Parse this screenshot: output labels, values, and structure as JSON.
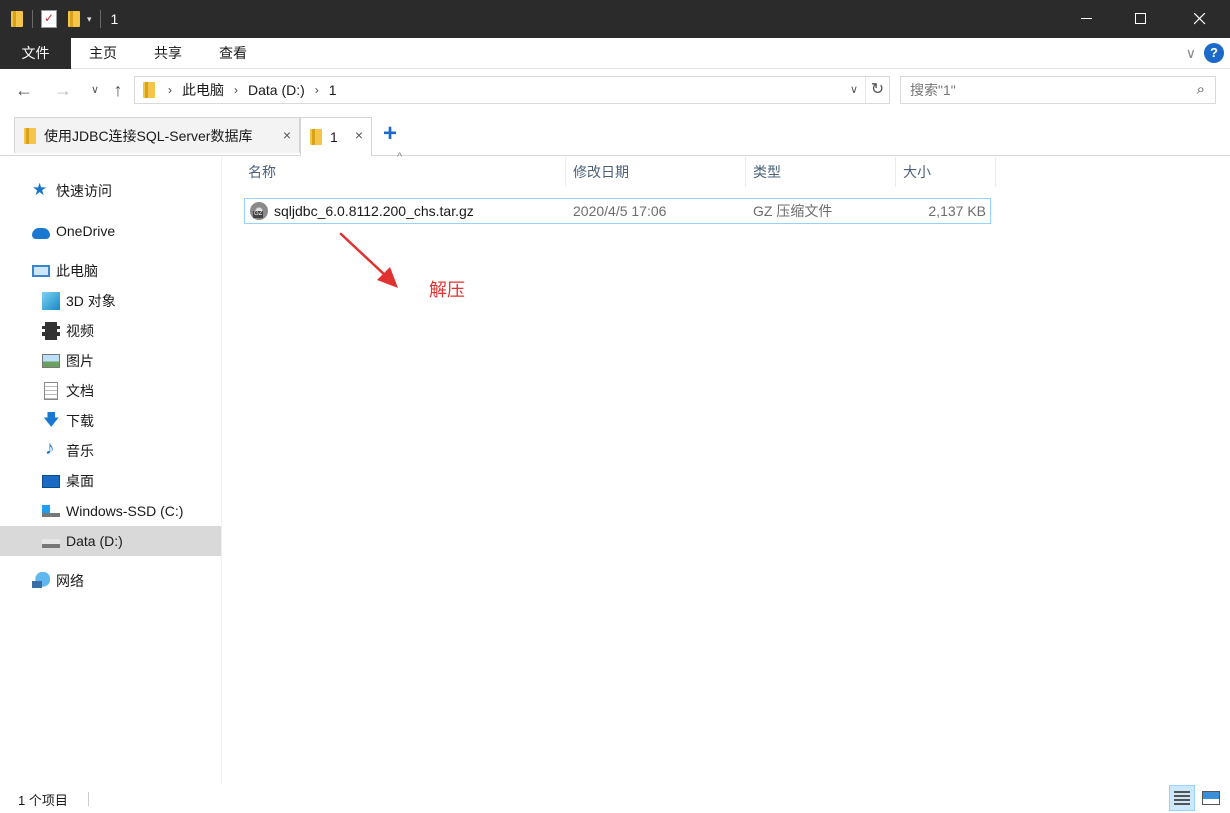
{
  "window": {
    "title": "1"
  },
  "ribbon": {
    "tabs": [
      "文件",
      "主页",
      "共享",
      "查看"
    ]
  },
  "address": {
    "crumbs": [
      "此电脑",
      "Data (D:)",
      "1"
    ]
  },
  "search": {
    "placeholder": "搜索\"1\""
  },
  "tabs": [
    {
      "label": "使用JDBC连接SQL-Server数据库"
    },
    {
      "label": "1"
    }
  ],
  "sidebar": {
    "items": [
      {
        "label": "快速访问",
        "icon": "quick-access-star-icon"
      },
      {
        "label": "OneDrive",
        "icon": "onedrive-cloud-icon"
      },
      {
        "label": "此电脑",
        "icon": "this-pc-icon"
      },
      {
        "label": "3D 对象",
        "icon": "3d-objects-icon"
      },
      {
        "label": "视频",
        "icon": "videos-icon"
      },
      {
        "label": "图片",
        "icon": "pictures-icon"
      },
      {
        "label": "文档",
        "icon": "documents-icon"
      },
      {
        "label": "下载",
        "icon": "downloads-icon"
      },
      {
        "label": "音乐",
        "icon": "music-icon"
      },
      {
        "label": "桌面",
        "icon": "desktop-icon"
      },
      {
        "label": "Windows-SSD (C:)",
        "icon": "drive-c-icon"
      },
      {
        "label": "Data (D:)",
        "icon": "drive-d-icon",
        "selected": true
      },
      {
        "label": "网络",
        "icon": "network-icon"
      }
    ]
  },
  "columns": {
    "name": "名称",
    "modified": "修改日期",
    "type": "类型",
    "size": "大小"
  },
  "files": [
    {
      "name": "sqljdbc_6.0.8112.200_chs.tar.gz",
      "modified": "2020/4/5 17:06",
      "type": "GZ 压缩文件",
      "size": "2,137 KB"
    }
  ],
  "annotation": {
    "text": "解压",
    "color": "#e0332f"
  },
  "status": {
    "items_count": "1 个项目"
  },
  "colors": {
    "accent": "#1b6ac9",
    "titlebar": "#2b2b2b",
    "selection": "#cce8ff"
  }
}
